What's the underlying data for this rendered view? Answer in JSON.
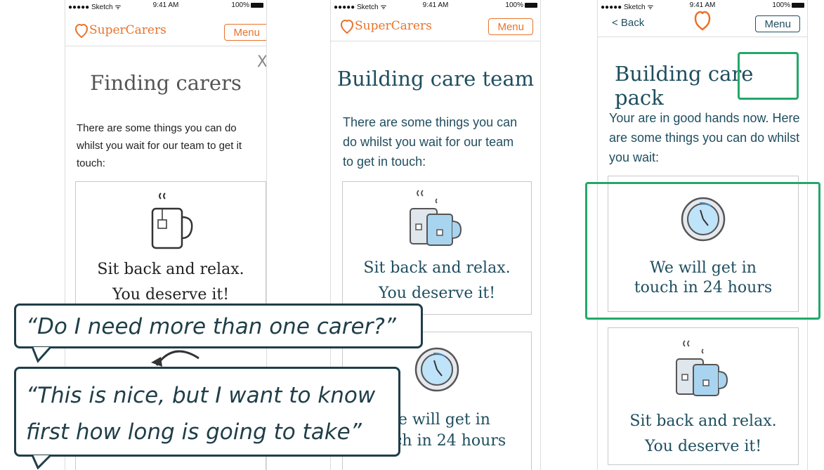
{
  "status": {
    "carrier": "●●●●● Sketch ᯤ",
    "time": "9:41 AM",
    "battery": "100%"
  },
  "screens": [
    {
      "logo": "SuperCarers",
      "menu": "Menu",
      "close": "X",
      "title": "Finding carers",
      "intro": "There are some things you can do whilst you wait for our team to get it touch:",
      "card1": {
        "line1": "Sit back and relax.",
        "line2": "You deserve it!"
      }
    },
    {
      "logo": "SuperCarers",
      "menu": "Menu",
      "title": "Building care team",
      "intro": "There are some things you can do whilst you wait for our team to get in touch:",
      "card1": {
        "line1": "Sit back and relax.",
        "line2": "You deserve it!"
      },
      "card2": {
        "line1": "We will get in",
        "line2": "touch in 24 hours"
      }
    },
    {
      "back": "< Back",
      "menu": "Menu",
      "title_a": "Building care",
      "title_b": "pack",
      "intro": "Your are in good hands now. Here are some things you can do whilst you wait:",
      "card1": {
        "line1": "We will get in",
        "line2": "touch in 24 hours"
      },
      "card2": {
        "line1": "Sit back and relax.",
        "line2": "You deserve it!"
      }
    }
  ],
  "quotes": {
    "q1": "“Do I need more than one carer?”",
    "q2_line1": "“This is nice, but I want to know",
    "q2_line2": "first how long is going to take”"
  },
  "colors": {
    "brand_orange": "#e8732a",
    "teal": "#1f4e5f",
    "highlight_green": "#23a869",
    "bubble": "#1f3e48"
  }
}
